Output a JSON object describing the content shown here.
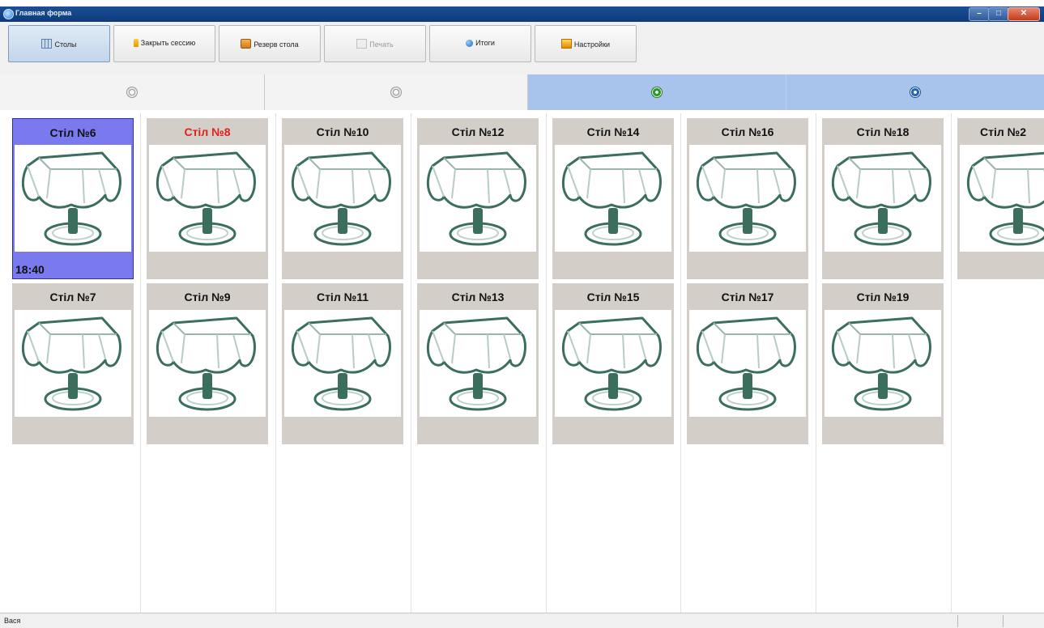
{
  "window": {
    "title": "Главная форма"
  },
  "toolbar": {
    "buttons": [
      {
        "label": "Столы",
        "icon": "tables-icon"
      },
      {
        "label": "Закрыть сессию",
        "icon": "candle-icon"
      },
      {
        "label": "Резерв стола",
        "icon": "reserve-icon"
      },
      {
        "label": "Печать",
        "icon": "print-icon"
      },
      {
        "label": "Итоги",
        "icon": "globe-icon"
      },
      {
        "label": "Настройки",
        "icon": "settings-icon"
      }
    ]
  },
  "tabs": [
    {
      "icon": "copyright-icon",
      "state": "inactive"
    },
    {
      "icon": "record-icon",
      "state": "inactive"
    },
    {
      "icon": "play-icon",
      "state": "highlighted"
    },
    {
      "icon": "refresh-icon",
      "state": "highlighted"
    }
  ],
  "tables": {
    "row1": [
      {
        "name": "Стіл №6",
        "time": "18:40",
        "selected": true
      },
      {
        "name": "Стіл №8",
        "alert": true
      },
      {
        "name": "Стіл №10"
      },
      {
        "name": "Стіл №12"
      },
      {
        "name": "Стіл №14"
      },
      {
        "name": "Стіл №16"
      },
      {
        "name": "Стіл №18"
      },
      {
        "name": "Стіл №2"
      }
    ],
    "row2": [
      {
        "name": "Стіл №7"
      },
      {
        "name": "Стіл №9"
      },
      {
        "name": "Стіл №11"
      },
      {
        "name": "Стіл №13"
      },
      {
        "name": "Стіл №15"
      },
      {
        "name": "Стіл №17"
      },
      {
        "name": "Стіл №19"
      }
    ]
  },
  "statusbar": {
    "user": "Вася"
  },
  "colors": {
    "selected": "#7b79ee",
    "alert": "#e0201a",
    "tab_highlight": "#a9c4ec"
  }
}
